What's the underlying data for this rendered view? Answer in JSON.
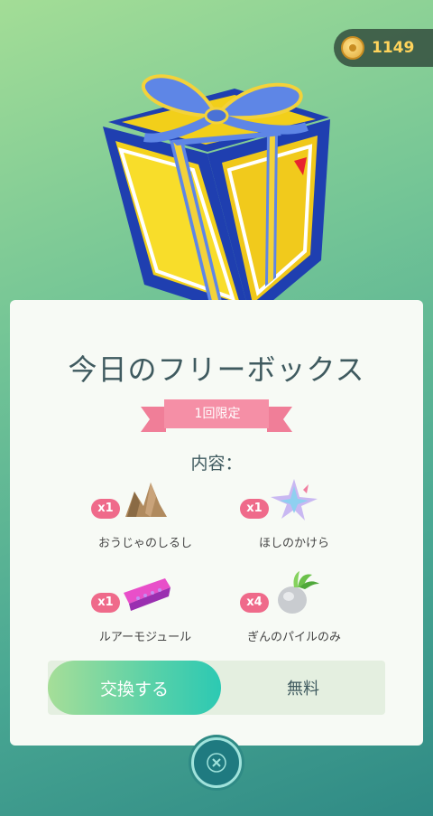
{
  "coins": {
    "amount": "1149",
    "icon": "coin-icon"
  },
  "box": {
    "image": "gift-box-icon",
    "title": "今日のフリーボックス",
    "limit_badge": "1回限定",
    "contents_label": "内容："
  },
  "items": [
    {
      "name": "おうじゃのしるし",
      "qty": "x1",
      "icon": "kings-rock-icon"
    },
    {
      "name": "ほしのかけら",
      "qty": "x1",
      "icon": "star-piece-icon"
    },
    {
      "name": "ルアーモジュール",
      "qty": "x1",
      "icon": "lure-module-icon"
    },
    {
      "name": "ぎんのパイルのみ",
      "qty": "x4",
      "icon": "silver-pinap-berry-icon"
    }
  ],
  "toggle": {
    "exchange_label": "交換する",
    "price_label": "無料"
  },
  "close": {
    "icon": "close-icon"
  },
  "colors": {
    "badge": "#ef6a8a",
    "accent": "#2cc9b3",
    "coin": "#ffd45c"
  }
}
